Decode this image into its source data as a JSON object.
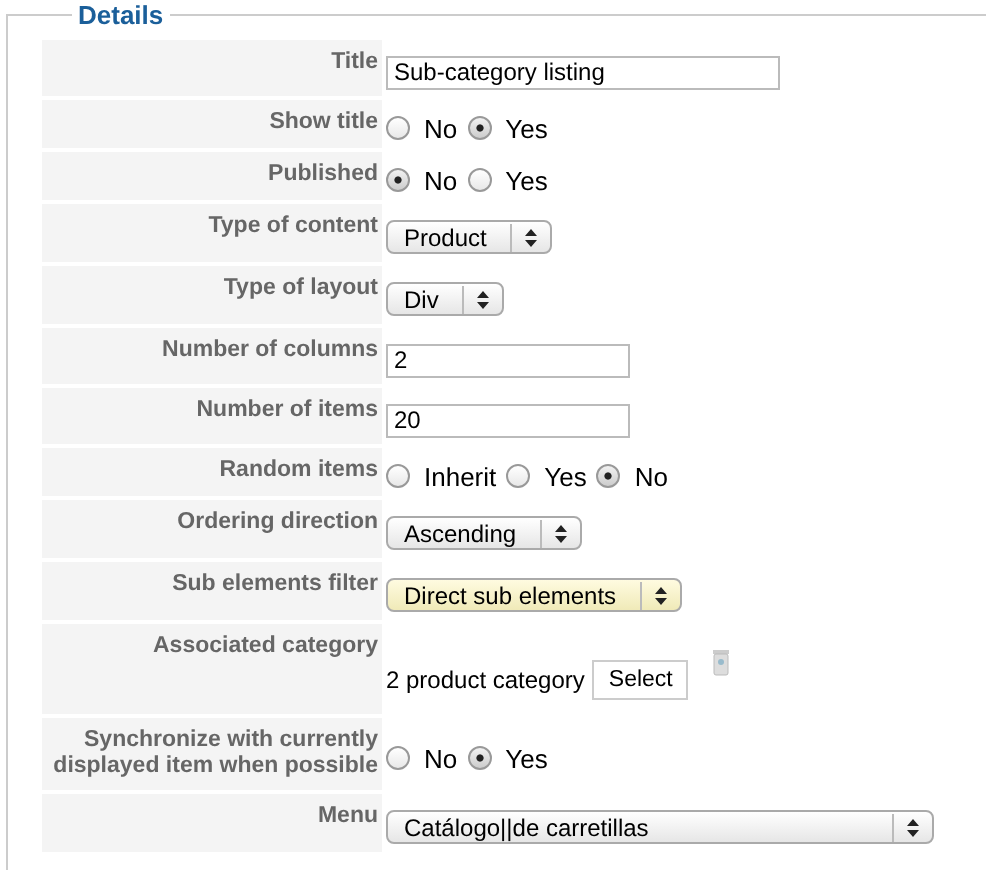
{
  "legend": "Details",
  "rows": [
    {
      "label": "Title",
      "kind": "text",
      "value": "Sub-category listing",
      "wide": true
    },
    {
      "label": "Show title",
      "kind": "radio",
      "options": [
        {
          "label": "No",
          "selected": false
        },
        {
          "label": "Yes",
          "selected": true
        }
      ]
    },
    {
      "label": "Published",
      "kind": "radio",
      "options": [
        {
          "label": "No",
          "selected": true
        },
        {
          "label": "Yes",
          "selected": false
        }
      ]
    },
    {
      "label": "Type of content",
      "kind": "select",
      "value": "Product",
      "highlighted": false
    },
    {
      "label": "Type of layout",
      "kind": "select",
      "value": "Div",
      "highlighted": false
    },
    {
      "label": "Number of columns",
      "kind": "text",
      "value": "2",
      "wide": false
    },
    {
      "label": "Number of items",
      "kind": "text",
      "value": "20",
      "wide": false
    },
    {
      "label": "Random items",
      "kind": "radio",
      "options": [
        {
          "label": "Inherit",
          "selected": false
        },
        {
          "label": "Yes",
          "selected": false
        },
        {
          "label": "No",
          "selected": true
        }
      ]
    },
    {
      "label": "Ordering direction",
      "kind": "select",
      "value": "Ascending",
      "highlighted": false
    },
    {
      "label": "Sub elements filter",
      "kind": "select",
      "value": "Direct sub elements",
      "highlighted": true
    },
    {
      "label": "Associated category",
      "kind": "category",
      "value": "2 product category",
      "button": "Select"
    },
    {
      "label": "Synchronize with currently displayed item when possible",
      "kind": "radio",
      "options": [
        {
          "label": "No",
          "selected": false
        },
        {
          "label": "Yes",
          "selected": true
        }
      ]
    },
    {
      "label": "Menu",
      "kind": "select",
      "value": "Catálogo||de carretillas",
      "highlighted": false,
      "full": true
    }
  ]
}
